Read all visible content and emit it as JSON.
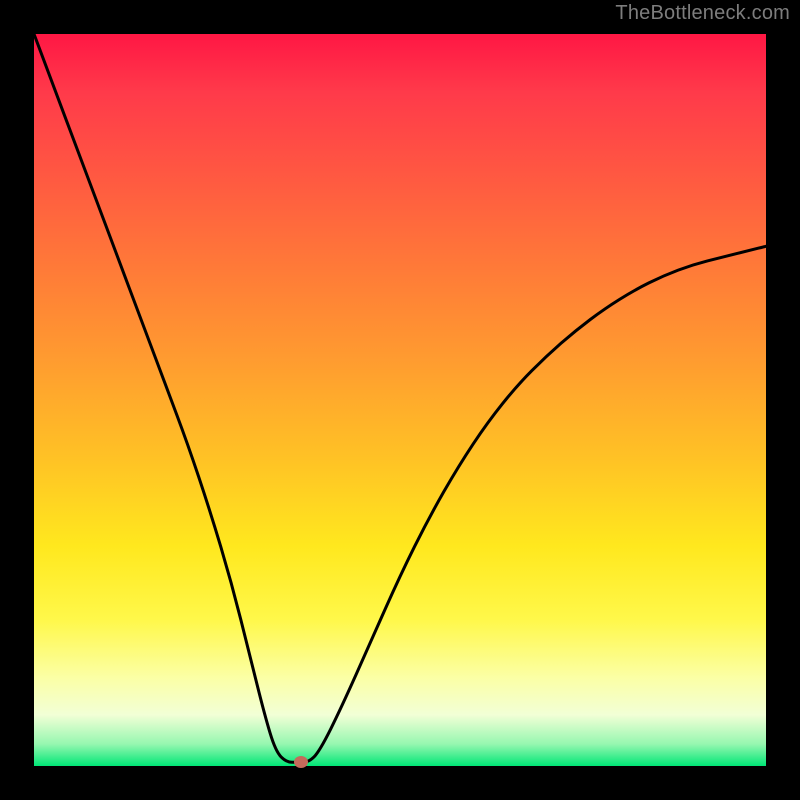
{
  "watermark": "TheBottleneck.com",
  "chart_data": {
    "type": "line",
    "title": "",
    "xlabel": "",
    "ylabel": "",
    "xlim": [
      0,
      1
    ],
    "ylim": [
      0,
      1
    ],
    "note": "Axes are unlabeled; values are normalized positions read from the plot area (0 = left/bottom, 1 = right/top).",
    "series": [
      {
        "name": "curve",
        "x": [
          0.0,
          0.03,
          0.06,
          0.09,
          0.12,
          0.15,
          0.18,
          0.21,
          0.24,
          0.27,
          0.295,
          0.315,
          0.33,
          0.345,
          0.36,
          0.375,
          0.39,
          0.42,
          0.46,
          0.5,
          0.54,
          0.58,
          0.62,
          0.66,
          0.7,
          0.74,
          0.78,
          0.82,
          0.86,
          0.9,
          0.94,
          0.98,
          1.0
        ],
        "y": [
          1.0,
          0.92,
          0.84,
          0.76,
          0.68,
          0.6,
          0.52,
          0.44,
          0.35,
          0.25,
          0.15,
          0.07,
          0.02,
          0.005,
          0.005,
          0.005,
          0.02,
          0.08,
          0.17,
          0.26,
          0.34,
          0.41,
          0.47,
          0.52,
          0.56,
          0.595,
          0.625,
          0.65,
          0.67,
          0.685,
          0.695,
          0.705,
          0.71
        ]
      }
    ],
    "marker": {
      "x": 0.365,
      "y": 0.0
    },
    "gradient_stops": [
      {
        "pos": 0.0,
        "color": "#ff1744"
      },
      {
        "pos": 0.2,
        "color": "#ff5a41"
      },
      {
        "pos": 0.44,
        "color": "#ff9a30"
      },
      {
        "pos": 0.7,
        "color": "#ffe81e"
      },
      {
        "pos": 0.88,
        "color": "#fbffa6"
      },
      {
        "pos": 1.0,
        "color": "#00e676"
      }
    ]
  },
  "colors": {
    "frame": "#000000",
    "curve": "#000000",
    "dot": "#c46a5b",
    "watermark": "#7d7d7d"
  }
}
